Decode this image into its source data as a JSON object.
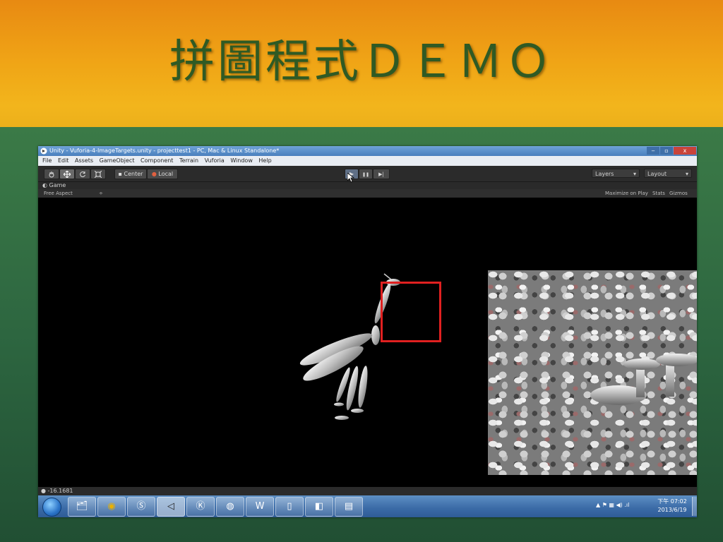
{
  "slide": {
    "title": "拼圖程式ＤＥＭＯ"
  },
  "window": {
    "title": "Unity - Vuforia-4-ImageTargets.unity - projecttest1 - PC, Mac & Linux Standalone*",
    "controls": {
      "minimize": "‒",
      "maximize": "▫",
      "close": "x"
    }
  },
  "menu": {
    "items": [
      "File",
      "Edit",
      "Assets",
      "GameObject",
      "Component",
      "Terrain",
      "Vuforia",
      "Window",
      "Help"
    ]
  },
  "toolbar": {
    "tools": [
      "hand-icon",
      "move-icon",
      "rotate-icon",
      "scale-icon"
    ],
    "pivot_label": "Center",
    "space_label": "Local",
    "play_icon": "▶",
    "pause_icon": "❚❚",
    "step_icon": "▶|",
    "layers_label": "Layers",
    "layout_label": "Layout"
  },
  "game": {
    "tab_label": "Game",
    "aspect_label": "Free Aspect",
    "maximize_label": "Maximize on Play",
    "stats_label": "Stats",
    "gizmos_label": "Gizmos"
  },
  "status": {
    "message": "-16.1681"
  },
  "taskbar": {
    "apps": [
      "file-explorer",
      "chrome",
      "skype",
      "unity",
      "kmplayer",
      "media-player",
      "word",
      "phone",
      "app",
      "video"
    ],
    "clock_period": "下午",
    "clock_time": "07:02",
    "clock_date": "2013/6/19"
  },
  "colors": {
    "target_frame": "#e02020",
    "title_text": "#2f5a24"
  }
}
